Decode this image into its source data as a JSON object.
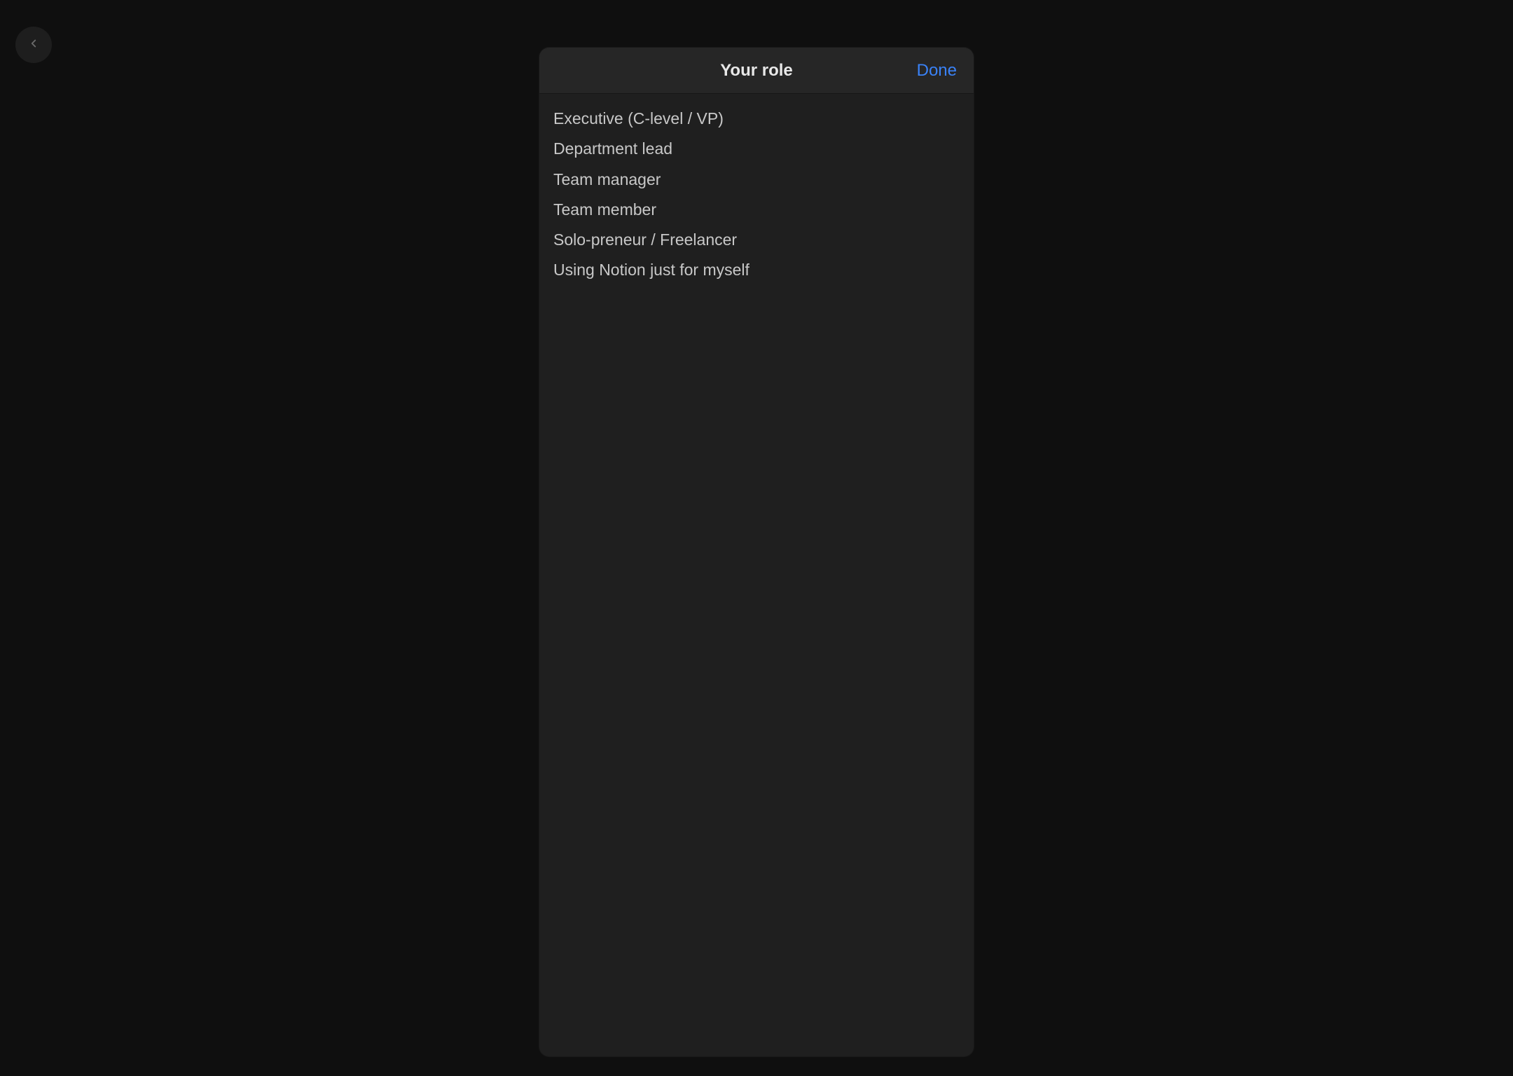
{
  "modal": {
    "title": "Your role",
    "done_label": "Done",
    "options": [
      "Executive (C-level / VP)",
      "Department lead",
      "Team manager",
      "Team member",
      "Solo-preneur / Freelancer",
      "Using Notion just for myself"
    ]
  },
  "colors": {
    "background": "#0f0f0f",
    "modal_bg": "#1f1f1f",
    "header_bg": "#262626",
    "text_primary": "#e8e8e8",
    "text_secondary": "#c8c8c8",
    "accent": "#3a82f7"
  }
}
